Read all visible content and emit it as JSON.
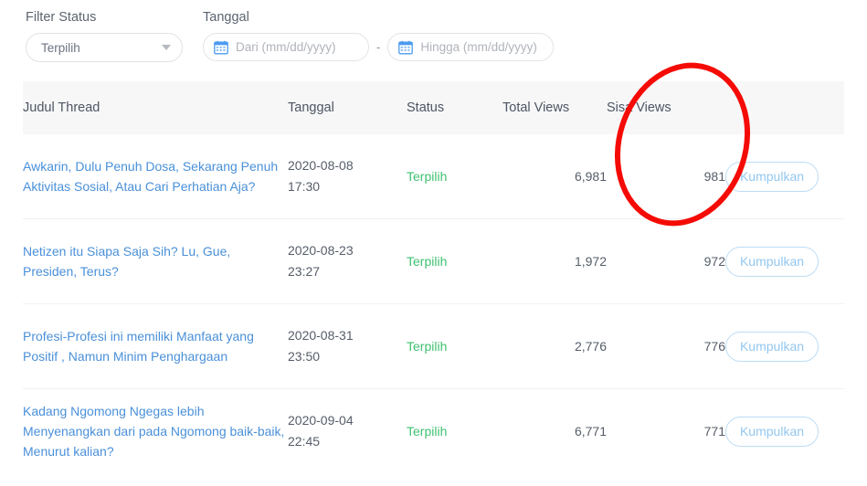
{
  "filters": {
    "status": {
      "label": "Filter Status",
      "selected": "Terpilih",
      "caret_icon": "chevron-down-icon"
    },
    "date": {
      "label": "Tanggal",
      "from_placeholder": "Dari (mm/dd/yyyy)",
      "from_value": "",
      "to_placeholder": "Hingga (mm/dd/yyyy)",
      "to_value": "",
      "separator": "-",
      "calendar_icon": "calendar-icon"
    }
  },
  "table": {
    "headers": {
      "title": "Judul Thread",
      "date": "Tanggal",
      "status": "Status",
      "total_views": "Total Views",
      "sisa_views": "Sisa Views",
      "action": ""
    },
    "rows": [
      {
        "title": "Awkarin, Dulu Penuh Dosa, Sekarang Penuh Aktivitas Sosial, Atau Cari Perhatian Aja?",
        "date": "2020-08-08",
        "time": "17:30",
        "status": "Terpilih",
        "total_views": "6,981",
        "sisa_views": "981",
        "action_label": "Kumpulkan"
      },
      {
        "title": "Netizen itu Siapa Saja Sih? Lu, Gue, Presiden, Terus?",
        "date": "2020-08-23",
        "time": "23:27",
        "status": "Terpilih",
        "total_views": "1,972",
        "sisa_views": "972",
        "action_label": "Kumpulkan"
      },
      {
        "title": "Profesi-Profesi ini memiliki Manfaat yang Positif , Namun Minim Penghargaan",
        "date": "2020-08-31",
        "time": "23:50",
        "status": "Terpilih",
        "total_views": "2,776",
        "sisa_views": "776",
        "action_label": "Kumpulkan"
      },
      {
        "title": "Kadang Ngomong Ngegas lebih Menyenangkan dari pada Ngomong baik-baik, Menurut kalian?",
        "date": "2020-09-04",
        "time": "22:45",
        "status": "Terpilih",
        "total_views": "6,771",
        "sisa_views": "771",
        "action_label": "Kumpulkan"
      }
    ]
  },
  "annotation": {
    "type": "ellipse-highlight",
    "color": "#f50b05",
    "target": "Sisa Views column"
  },
  "colors": {
    "link": "#4a90d9",
    "status_green": "#3fc271",
    "header_bg": "#f7f7f8",
    "button_border": "#bcdcf5",
    "button_text": "#93c7ef",
    "annotation_red": "#f50b05"
  }
}
